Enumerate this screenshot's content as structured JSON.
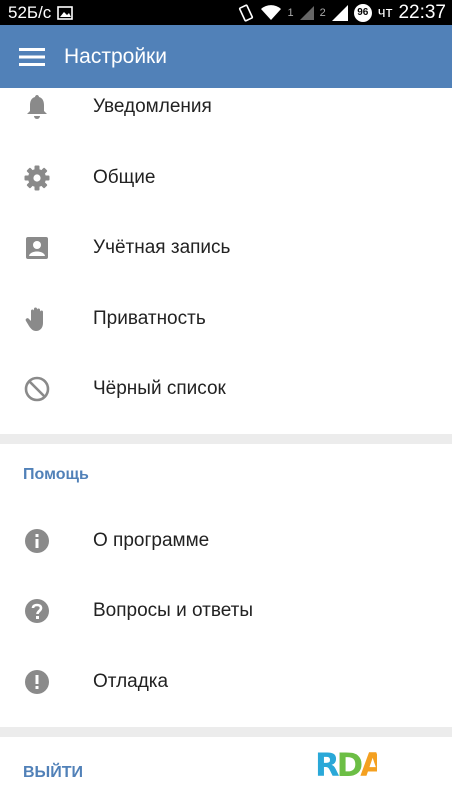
{
  "status_bar": {
    "speed": "52Б/с",
    "sim1": "1",
    "sim2": "2",
    "battery": "96",
    "day": "чт",
    "time": "22:37",
    "icons": [
      "image-icon",
      "vibrate-icon",
      "wifi-icon",
      "signal-icon",
      "signal-icon",
      "battery-badge"
    ]
  },
  "app_bar": {
    "title": "Настройки",
    "menu_icon": "hamburger-menu-icon",
    "background": "#5181b8"
  },
  "settings": {
    "items": [
      {
        "label": "Уведомления",
        "icon": "bell-icon"
      },
      {
        "label": "Общие",
        "icon": "gear-icon"
      },
      {
        "label": "Учётная запись",
        "icon": "account-box-icon"
      },
      {
        "label": "Приватность",
        "icon": "hand-icon"
      },
      {
        "label": "Чёрный список",
        "icon": "block-icon"
      }
    ]
  },
  "help": {
    "header": "Помощь",
    "items": [
      {
        "label": "О программе",
        "icon": "info-icon"
      },
      {
        "label": "Вопросы и ответы",
        "icon": "help-icon"
      },
      {
        "label": "Отладка",
        "icon": "alert-icon"
      }
    ]
  },
  "logout": {
    "label": "ВЫЙТИ"
  },
  "watermark": {
    "text": "RDA",
    "colors": [
      "#2aa8d8",
      "#6cbe45",
      "#f4a020"
    ]
  },
  "colors": {
    "accent": "#5181b8",
    "icon_gray": "#8a8a8a",
    "band": "#ececec"
  }
}
